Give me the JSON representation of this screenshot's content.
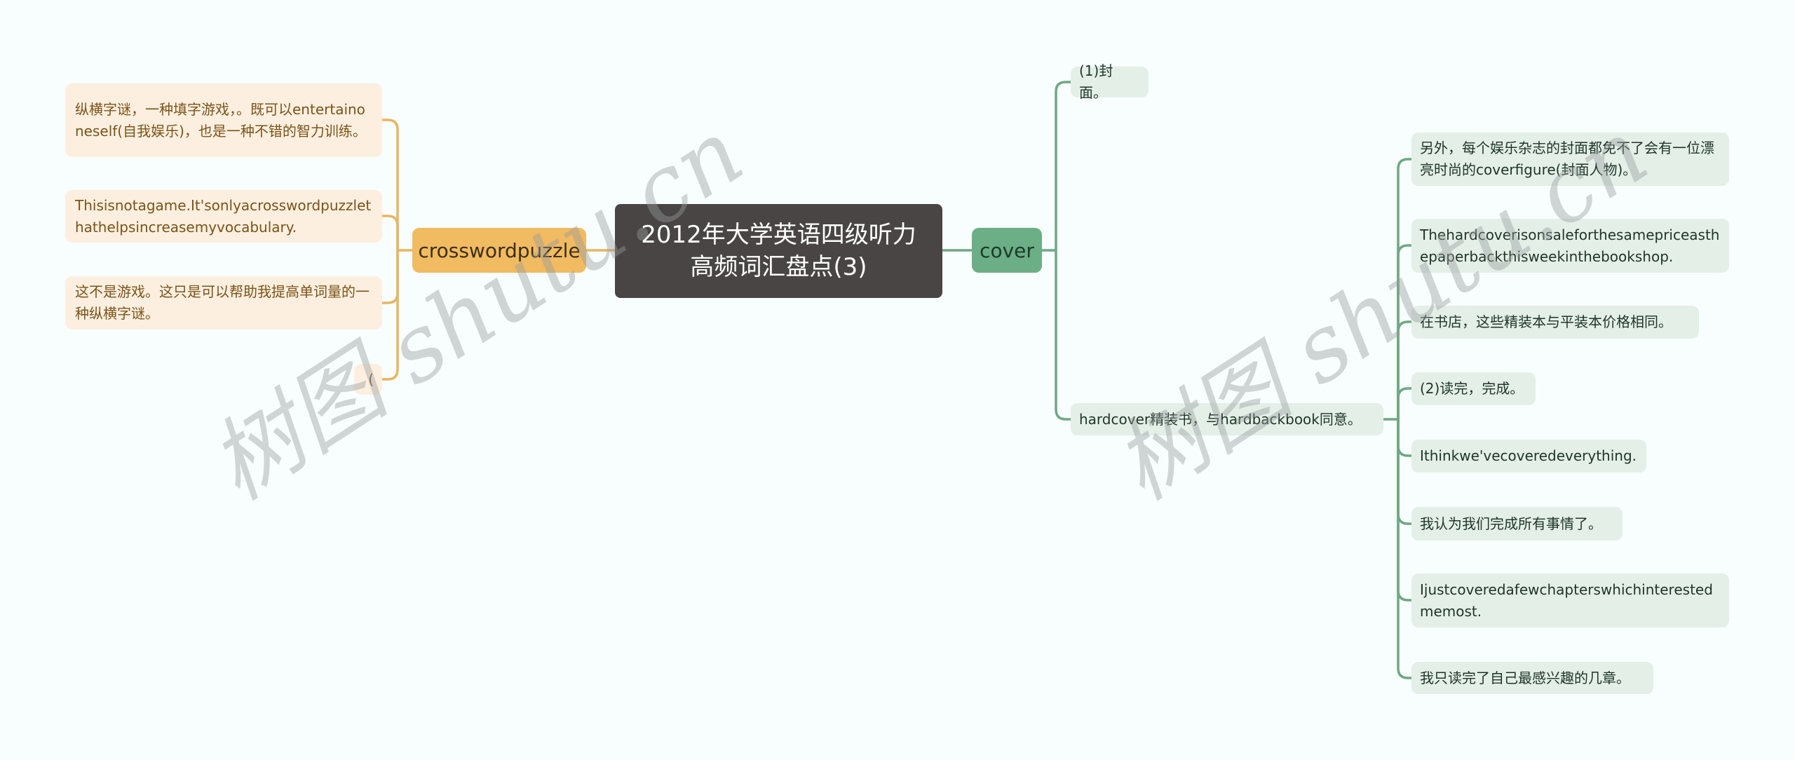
{
  "root": {
    "title_line1": "2012年大学英语四级听力",
    "title_line2": "高频词汇盘点(3)"
  },
  "colors": {
    "left_branch": "#e8b660",
    "right_branch": "#6fa884",
    "root_bg": "#4a4545"
  },
  "left_branch": {
    "label": "crosswordpuzzle",
    "children": [
      {
        "text": "纵横字谜，一种填字游戏，。既可以entertainoneself(自我娱乐)，也是一种不错的智力训练。"
      },
      {
        "text": "Thisisnotagame.It'sonlyacrosswordpuzzlethathelpsincreasemyvocabulary."
      },
      {
        "text": "这不是游戏。这只是可以帮助我提高单词量的一种纵横字谜。"
      },
      {
        "text": "("
      }
    ]
  },
  "right_branch": {
    "label": "cover",
    "children": [
      {
        "text": "(1)封面。"
      },
      {
        "text": "hardcover精装书，与hardbackbook同意。",
        "children": [
          {
            "text": "另外，每个娱乐杂志的封面都免不了会有一位漂亮时尚的coverfigure(封面人物)。"
          },
          {
            "text": "Thehardcoverisonsaleforthesamepriceasthepaperbackthisweekinthebookshop."
          },
          {
            "text": "在书店，这些精装本与平装本价格相同。"
          },
          {
            "text": "(2)读完，完成。"
          },
          {
            "text": "Ithinkwe'vecoveredeverything."
          },
          {
            "text": "我认为我们完成所有事情了。"
          },
          {
            "text": "Ijustcoveredafewchapterswhichinterestedmemost."
          },
          {
            "text": "我只读完了自己最感兴趣的几章。"
          }
        ]
      }
    ]
  },
  "watermark": {
    "text": "树图 shutu.cn"
  }
}
